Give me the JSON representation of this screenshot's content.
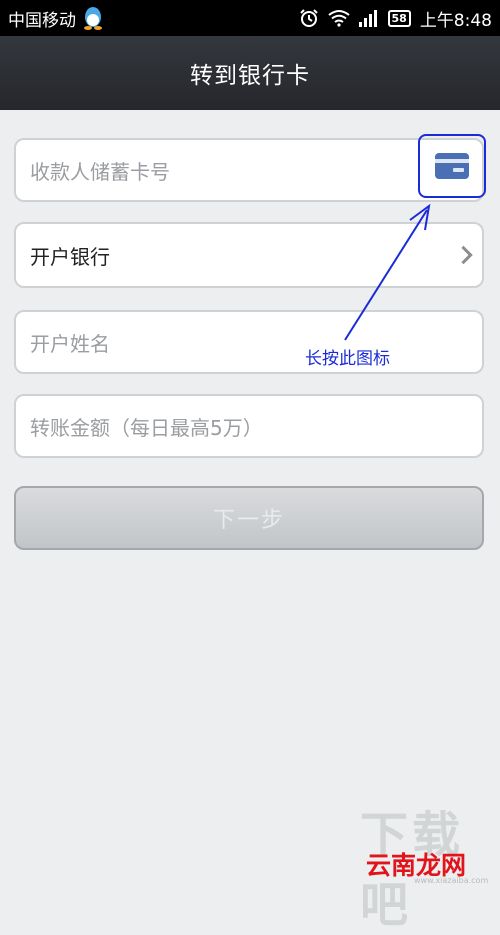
{
  "status_bar": {
    "carrier": "中国移动",
    "battery": "58",
    "time": "上午8:48",
    "icons": [
      "qq-icon",
      "alarm-icon",
      "wifi-icon",
      "signal-icon",
      "battery-icon"
    ]
  },
  "header": {
    "title": "转到银行卡"
  },
  "form": {
    "card_number_placeholder": "收款人储蓄卡号",
    "bank_label": "开户银行",
    "name_placeholder": "开户姓名",
    "amount_placeholder": "转账金额（每日最高5万）"
  },
  "next_button_label": "下一步",
  "annotation": {
    "text": "长按此图标",
    "color": "#1c2bd8"
  },
  "watermark": {
    "faint": "下载吧",
    "logo": "云南龙网",
    "url": "www.xiazaiba.com"
  },
  "colors": {
    "background": "#eceeef",
    "header": "#2b2d33",
    "accent": "#4a6fb5"
  }
}
